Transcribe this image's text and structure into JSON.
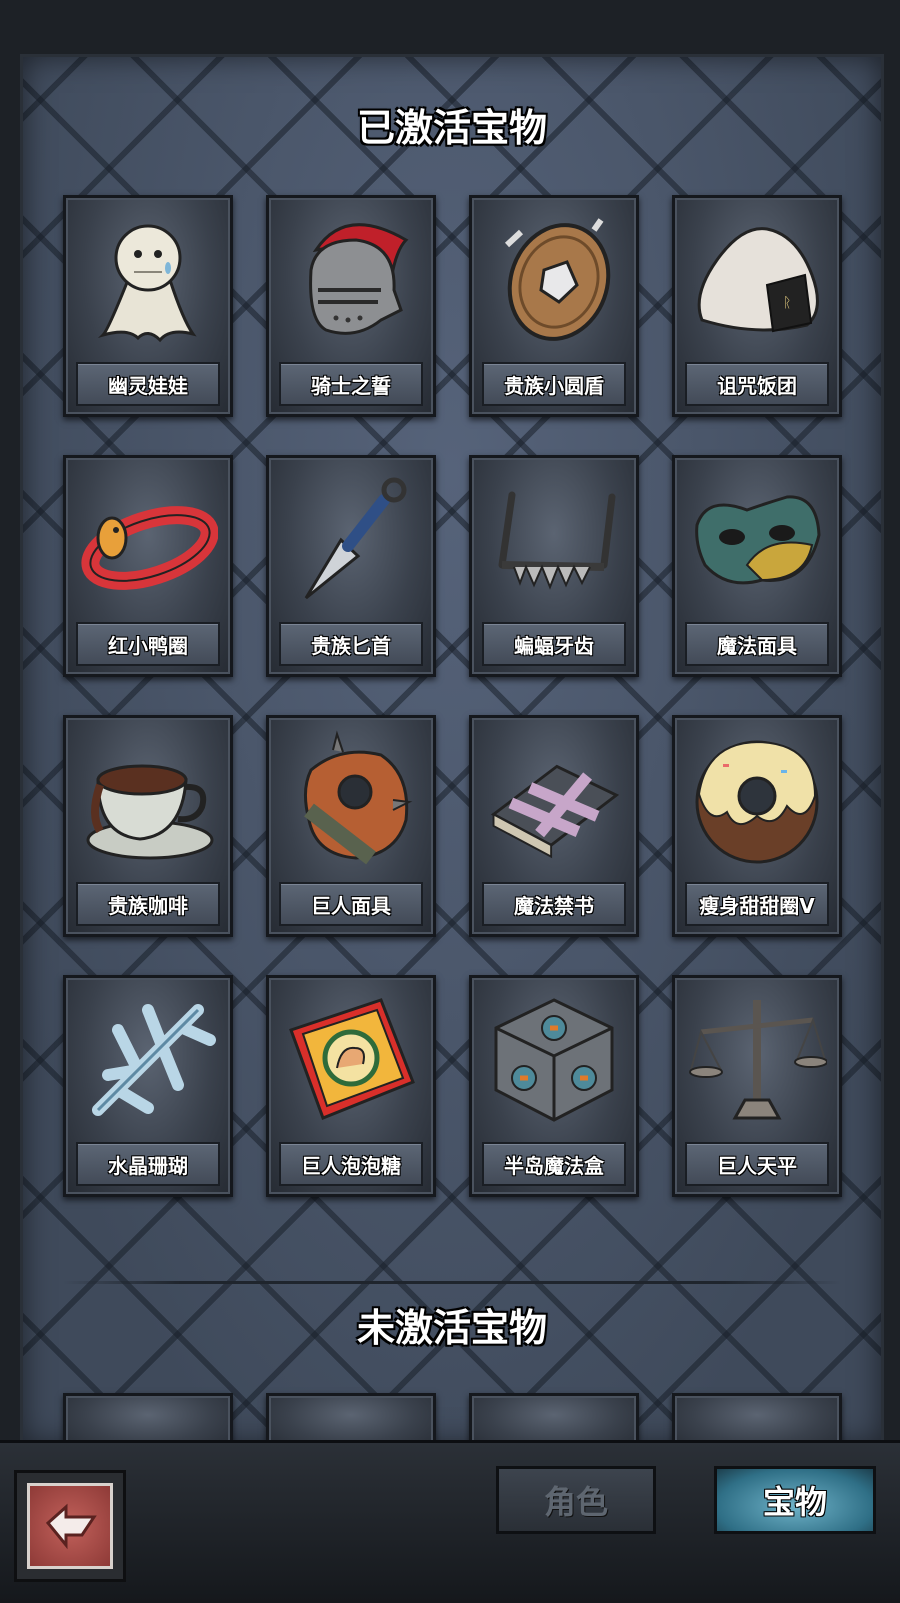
{
  "sections": {
    "active_title": "已激活宝物",
    "inactive_title": "未激活宝物"
  },
  "active_items": [
    {
      "name": "幽灵娃娃",
      "icon": "ghost-doll-icon"
    },
    {
      "name": "骑士之誓",
      "icon": "knight-helmet-icon"
    },
    {
      "name": "贵族小圆盾",
      "icon": "round-shield-icon"
    },
    {
      "name": "诅咒饭团",
      "icon": "rice-ball-icon"
    },
    {
      "name": "红小鸭圈",
      "icon": "duck-ring-icon"
    },
    {
      "name": "贵族匕首",
      "icon": "dagger-icon"
    },
    {
      "name": "蝙蝠牙齿",
      "icon": "bat-teeth-icon"
    },
    {
      "name": "魔法面具",
      "icon": "magic-mask-icon"
    },
    {
      "name": "贵族咖啡",
      "icon": "coffee-cup-icon"
    },
    {
      "name": "巨人面具",
      "icon": "giant-mask-icon"
    },
    {
      "name": "魔法禁书",
      "icon": "forbidden-book-icon"
    },
    {
      "name": "瘦身甜甜圈V",
      "icon": "donut-icon"
    },
    {
      "name": "水晶珊瑚",
      "icon": "crystal-coral-icon"
    },
    {
      "name": "巨人泡泡糖",
      "icon": "bubble-gum-icon"
    },
    {
      "name": "半岛魔法盒",
      "icon": "magic-box-icon"
    },
    {
      "name": "巨人天平",
      "icon": "scale-icon"
    }
  ],
  "bottom_bar": {
    "back_icon": "back-arrow-icon",
    "tab_role": "角色",
    "tab_treasure": "宝物",
    "active_tab": "宝物"
  },
  "colors": {
    "panel": "#4a5566",
    "card": "#3a414c",
    "back_button": "#a84b47",
    "active_tab": "#2f6f86"
  }
}
